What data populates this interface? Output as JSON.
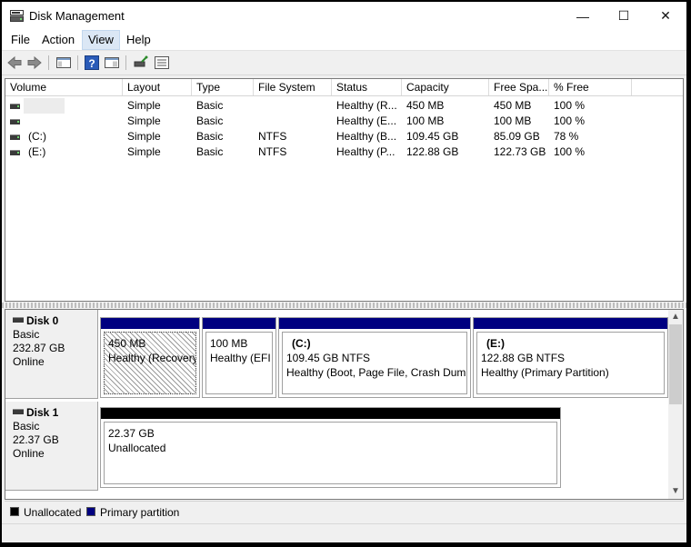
{
  "window": {
    "title": "Disk Management",
    "controls": {
      "minimize": "—",
      "maximize": "☐",
      "close": "✕"
    }
  },
  "menu": {
    "file": "File",
    "action": "Action",
    "view": "View",
    "help": "Help"
  },
  "toolbar": {
    "icons": [
      "back-arrow-icon",
      "forward-arrow-icon",
      "console-tree-icon",
      "help-icon",
      "properties-icon",
      "disk-connect-icon",
      "details-icon"
    ]
  },
  "volumes": {
    "columns": [
      "Volume",
      "Layout",
      "Type",
      "File System",
      "Status",
      "Capacity",
      "Free Spa...",
      "% Free"
    ],
    "rows": [
      {
        "volume": "",
        "layout": "Simple",
        "type": "Basic",
        "fs": "",
        "status": "Healthy (R...",
        "capacity": "450 MB",
        "free": "450 MB",
        "pct": "100 %"
      },
      {
        "volume": "",
        "layout": "Simple",
        "type": "Basic",
        "fs": "",
        "status": "Healthy (E...",
        "capacity": "100 MB",
        "free": "100 MB",
        "pct": "100 %"
      },
      {
        "volume": "(C:)",
        "layout": "Simple",
        "type": "Basic",
        "fs": "NTFS",
        "status": "Healthy (B...",
        "capacity": "109.45 GB",
        "free": "85.09 GB",
        "pct": "78 %"
      },
      {
        "volume": "(E:)",
        "layout": "Simple",
        "type": "Basic",
        "fs": "NTFS",
        "status": "Healthy (P...",
        "capacity": "122.88 GB",
        "free": "122.73 GB",
        "pct": "100 %"
      }
    ]
  },
  "disks": [
    {
      "name": "Disk 0",
      "type": "Basic",
      "size": "232.87 GB",
      "state": "Online",
      "partitions": [
        {
          "label": "",
          "size": "450 MB",
          "status": "Healthy (Recovery"
        },
        {
          "label": "",
          "size": "100 MB",
          "status": "Healthy (EFI S"
        },
        {
          "label": "(C:)",
          "size": "109.45 GB NTFS",
          "status": "Healthy (Boot, Page File, Crash Dump"
        },
        {
          "label": "(E:)",
          "size": "122.88 GB NTFS",
          "status": "Healthy (Primary Partition)"
        }
      ]
    },
    {
      "name": "Disk 1",
      "type": "Basic",
      "size": "22.37 GB",
      "state": "Online",
      "partitions": [
        {
          "label": "",
          "size": "22.37 GB",
          "status": "Unallocated"
        }
      ]
    }
  ],
  "legend": {
    "unallocated": "Unallocated",
    "primary": "Primary partition"
  },
  "colors": {
    "primary": "#000080",
    "unallocated": "#000000"
  }
}
